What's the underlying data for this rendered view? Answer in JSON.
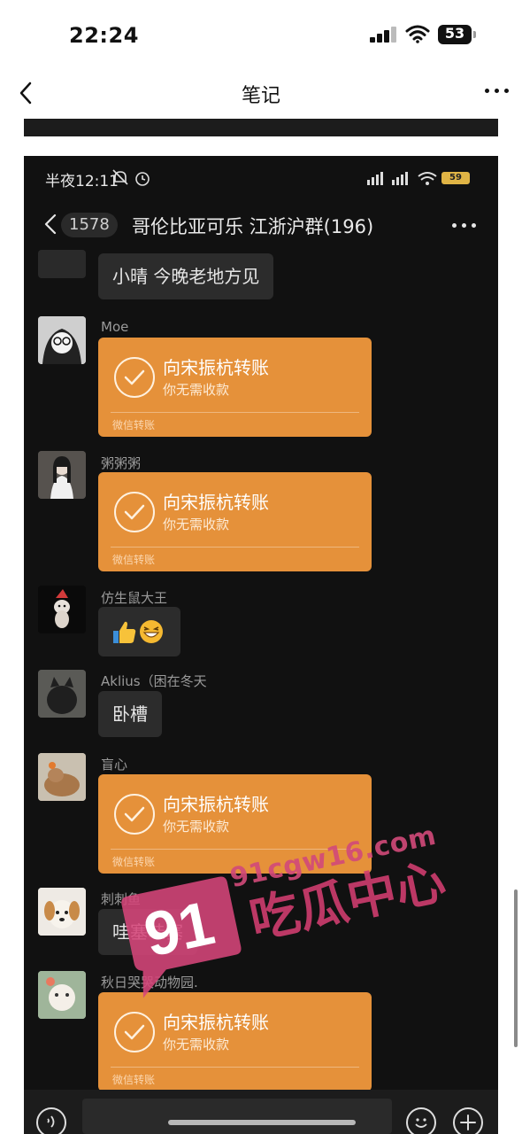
{
  "ios": {
    "time": "22:24",
    "battery": "53"
  },
  "notes_nav": {
    "title": "笔记"
  },
  "wechat": {
    "status_time": "半夜12:11",
    "battery": "59",
    "unread_count": "1578",
    "chat_title": "哥伦比亚可乐 江浙沪群(196)",
    "messages": [
      {
        "type": "text",
        "sender": "",
        "text": "小晴 今晚老地方见"
      },
      {
        "type": "transfer",
        "sender": "Moe",
        "title": "向宋振杭转账",
        "subtitle": "你无需收款",
        "footer": "微信转账"
      },
      {
        "type": "transfer",
        "sender": "粥粥粥",
        "title": "向宋振杭转账",
        "subtitle": "你无需收款",
        "footer": "微信转账"
      },
      {
        "type": "emoji",
        "sender": "仿生鼠大王",
        "text": "👍😁"
      },
      {
        "type": "text",
        "sender": "Aklius（困在冬天",
        "text": "卧槽"
      },
      {
        "type": "transfer",
        "sender": "盲心",
        "title": "向宋振杭转账",
        "subtitle": "你无需收款",
        "footer": "微信转账"
      },
      {
        "type": "text",
        "sender": "刺刺鱼",
        "text": "哇塞哇塞"
      },
      {
        "type": "transfer",
        "sender": "秋日哭哭动物园.",
        "title": "向宋振杭转账",
        "subtitle": "你无需收款",
        "footer": "微信转账"
      }
    ]
  },
  "watermark": {
    "badge": "91",
    "url": "91cgw16.com",
    "text": "吃瓜中心"
  },
  "colors": {
    "transfer_orange": "#e5913a",
    "chat_bg": "#111111",
    "watermark_pink": "#cf3d6f"
  }
}
